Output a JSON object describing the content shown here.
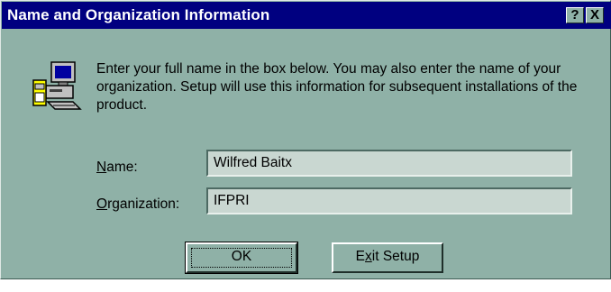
{
  "window": {
    "title": "Name and Organization Information",
    "help_button": "?",
    "close_button": "X"
  },
  "intro_text": "Enter your full name in the box below. You may also enter the name of your organization. Setup will use this information for subsequent installations of the product.",
  "form": {
    "name_label_mnemonic": "N",
    "name_label_rest": "ame:",
    "name_value": "Wilfred Baitx",
    "org_label_mnemonic": "O",
    "org_label_rest": "rganization:",
    "org_value": "IFPRI"
  },
  "buttons": {
    "ok_label": "OK",
    "exit_pre": "E",
    "exit_mnemonic": "x",
    "exit_post": "it Setup"
  },
  "icon": "computer-setup-icon",
  "colors": {
    "titlebar": "#000080",
    "dialog_face": "#8fb1a7",
    "field_bg": "#c9d7d1"
  }
}
